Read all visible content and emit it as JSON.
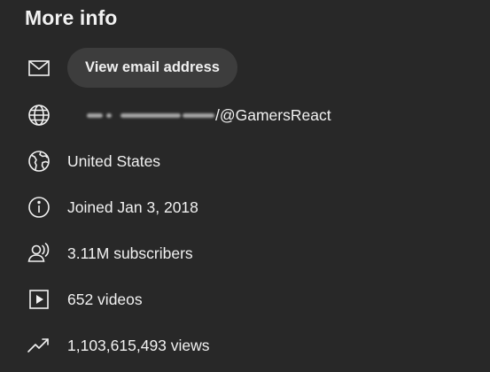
{
  "section": {
    "title": "More info"
  },
  "email": {
    "icon": "mail-icon",
    "button_label": "View email address"
  },
  "link": {
    "icon": "globe-grid-icon",
    "visible_text": "/@GamersReact"
  },
  "location": {
    "icon": "globe-earth-icon",
    "text": "United States"
  },
  "joined": {
    "icon": "info-icon",
    "text": "Joined Jan 3, 2018"
  },
  "subscribers": {
    "icon": "subscribers-icon",
    "text": "3.11M subscribers"
  },
  "videos": {
    "icon": "video-play-icon",
    "text": "652 videos"
  },
  "views": {
    "icon": "trending-up-icon",
    "text": "1,103,615,493 views"
  },
  "colors": {
    "background": "#282828",
    "text": "#f1f1f1",
    "button_background": "#3d3d3d"
  }
}
